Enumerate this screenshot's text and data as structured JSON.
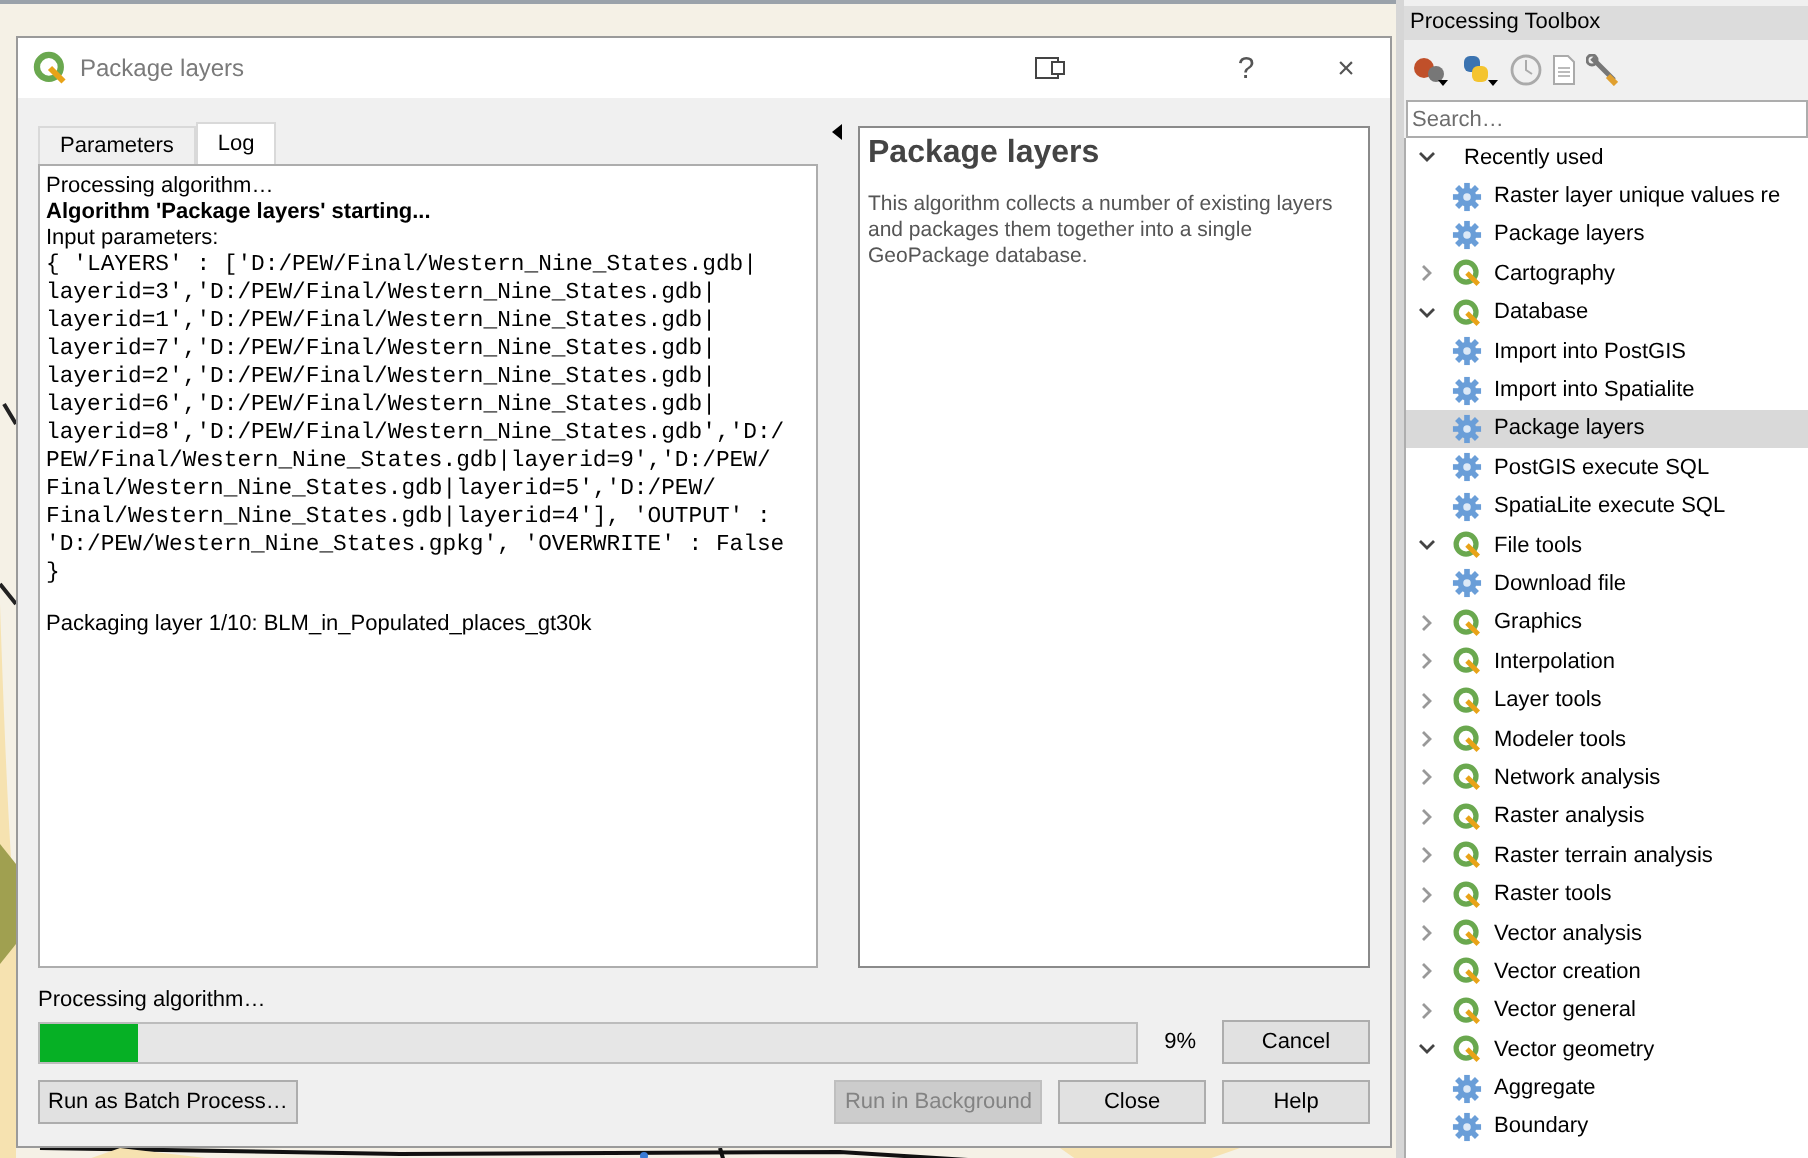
{
  "dialog": {
    "title": "Package layers",
    "help_button": "?",
    "close_button": "×",
    "tabs": [
      {
        "label": "Parameters",
        "selected": false
      },
      {
        "label": "Log",
        "selected": true
      }
    ],
    "log": {
      "intro": "Processing algorithm…",
      "heading": "Algorithm 'Package layers' starting...",
      "params_label": "Input parameters:",
      "params_lines": [
        "{ 'LAYERS' : ['D:/PEW/Final/Western_Nine_States.gdb|",
        "layerid=3','D:/PEW/Final/Western_Nine_States.gdb|",
        "layerid=1','D:/PEW/Final/Western_Nine_States.gdb|",
        "layerid=7','D:/PEW/Final/Western_Nine_States.gdb|",
        "layerid=2','D:/PEW/Final/Western_Nine_States.gdb|",
        "layerid=6','D:/PEW/Final/Western_Nine_States.gdb|",
        "layerid=8','D:/PEW/Final/Western_Nine_States.gdb','D:/",
        "PEW/Final/Western_Nine_States.gdb|layerid=9','D:/PEW/",
        "Final/Western_Nine_States.gdb|layerid=5','D:/PEW/",
        "Final/Western_Nine_States.gdb|layerid=4'], 'OUTPUT' :",
        "'D:/PEW/Western_Nine_States.gpkg', 'OVERWRITE' : False",
        "}"
      ],
      "status": "Packaging layer 1/10: BLM_in_Populated_places_gt30k"
    },
    "help": {
      "title": "Package layers",
      "text": "This algorithm collects a number of existing layers and packages them together into a single GeoPackage database."
    },
    "progress": {
      "label": "Processing algorithm…",
      "level": 0.09,
      "reading": "9%"
    },
    "buttons": [
      {
        "label": "Cancel",
        "disabled": false
      },
      {
        "label": "Run as Batch Process…",
        "disabled": false
      },
      {
        "label": "Run in Background",
        "disabled": true
      },
      {
        "label": "Close",
        "disabled": false
      },
      {
        "label": "Help",
        "disabled": false
      }
    ]
  },
  "toolbox": {
    "title": "Processing Toolbox",
    "search": {
      "placeholder": "Search…"
    },
    "tree": [
      {
        "label": "Recently used",
        "kind": "group",
        "expanded": true,
        "selected": false,
        "children": [
          {
            "label": "Raster layer unique values re",
            "kind": "algorithm",
            "selected": false
          },
          {
            "label": "Package layers",
            "kind": "algorithm",
            "selected": false
          }
        ]
      },
      {
        "label": "Cartography",
        "kind": "provider",
        "expanded": false,
        "selected": false
      },
      {
        "label": "Database",
        "kind": "provider",
        "expanded": true,
        "selected": false,
        "children": [
          {
            "label": "Import into PostGIS",
            "kind": "algorithm",
            "selected": false
          },
          {
            "label": "Import into Spatialite",
            "kind": "algorithm",
            "selected": false
          },
          {
            "label": "Package layers",
            "kind": "algorithm",
            "selected": true
          },
          {
            "label": "PostGIS execute SQL",
            "kind": "algorithm",
            "selected": false
          },
          {
            "label": "SpatiaLite execute SQL",
            "kind": "algorithm",
            "selected": false
          }
        ]
      },
      {
        "label": "File tools",
        "kind": "provider",
        "expanded": true,
        "selected": false,
        "children": [
          {
            "label": "Download file",
            "kind": "algorithm",
            "selected": false
          }
        ]
      },
      {
        "label": "Graphics",
        "kind": "provider",
        "expanded": false,
        "selected": false
      },
      {
        "label": "Interpolation",
        "kind": "provider",
        "expanded": false,
        "selected": false
      },
      {
        "label": "Layer tools",
        "kind": "provider",
        "expanded": false,
        "selected": false
      },
      {
        "label": "Modeler tools",
        "kind": "provider",
        "expanded": false,
        "selected": false
      },
      {
        "label": "Network analysis",
        "kind": "provider",
        "expanded": false,
        "selected": false
      },
      {
        "label": "Raster analysis",
        "kind": "provider",
        "expanded": false,
        "selected": false
      },
      {
        "label": "Raster terrain analysis",
        "kind": "provider",
        "expanded": false,
        "selected": false
      },
      {
        "label": "Raster tools",
        "kind": "provider",
        "expanded": false,
        "selected": false
      },
      {
        "label": "Vector analysis",
        "kind": "provider",
        "expanded": false,
        "selected": false
      },
      {
        "label": "Vector creation",
        "kind": "provider",
        "expanded": false,
        "selected": false
      },
      {
        "label": "Vector general",
        "kind": "provider",
        "expanded": false,
        "selected": false
      },
      {
        "label": "Vector geometry",
        "kind": "provider",
        "expanded": true,
        "selected": false,
        "children": [
          {
            "label": "Aggregate",
            "kind": "algorithm",
            "selected": false
          },
          {
            "label": "Boundary",
            "kind": "algorithm",
            "selected": false
          }
        ]
      }
    ]
  }
}
